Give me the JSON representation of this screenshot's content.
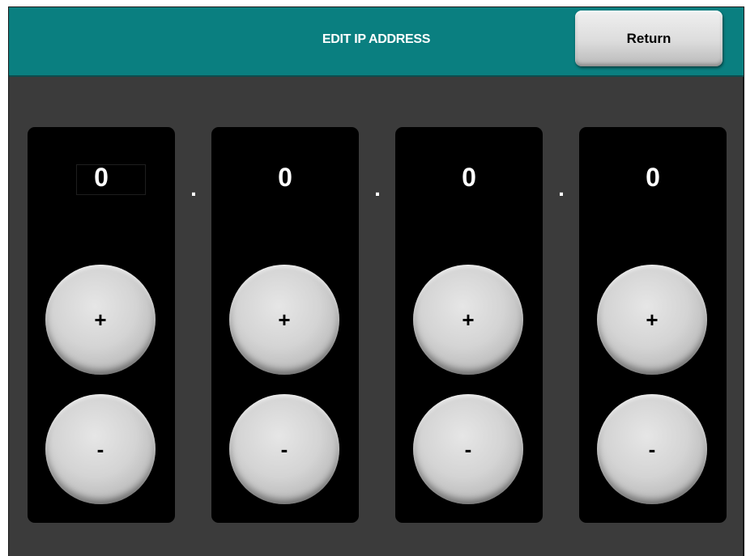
{
  "header": {
    "title": "EDIT IP ADDRESS",
    "return_label": "Return"
  },
  "separator": ".",
  "octets": [
    {
      "value": "0",
      "plus_label": "+",
      "minus_label": "-"
    },
    {
      "value": "0",
      "plus_label": "+",
      "minus_label": "-"
    },
    {
      "value": "0",
      "plus_label": "+",
      "minus_label": "-"
    },
    {
      "value": "0",
      "plus_label": "+",
      "minus_label": "-"
    }
  ],
  "colors": {
    "header_bg": "#0a7f80",
    "screen_bg": "#3b3b3b",
    "panel_bg": "#000000",
    "button_gray": "#d4d4d4"
  }
}
